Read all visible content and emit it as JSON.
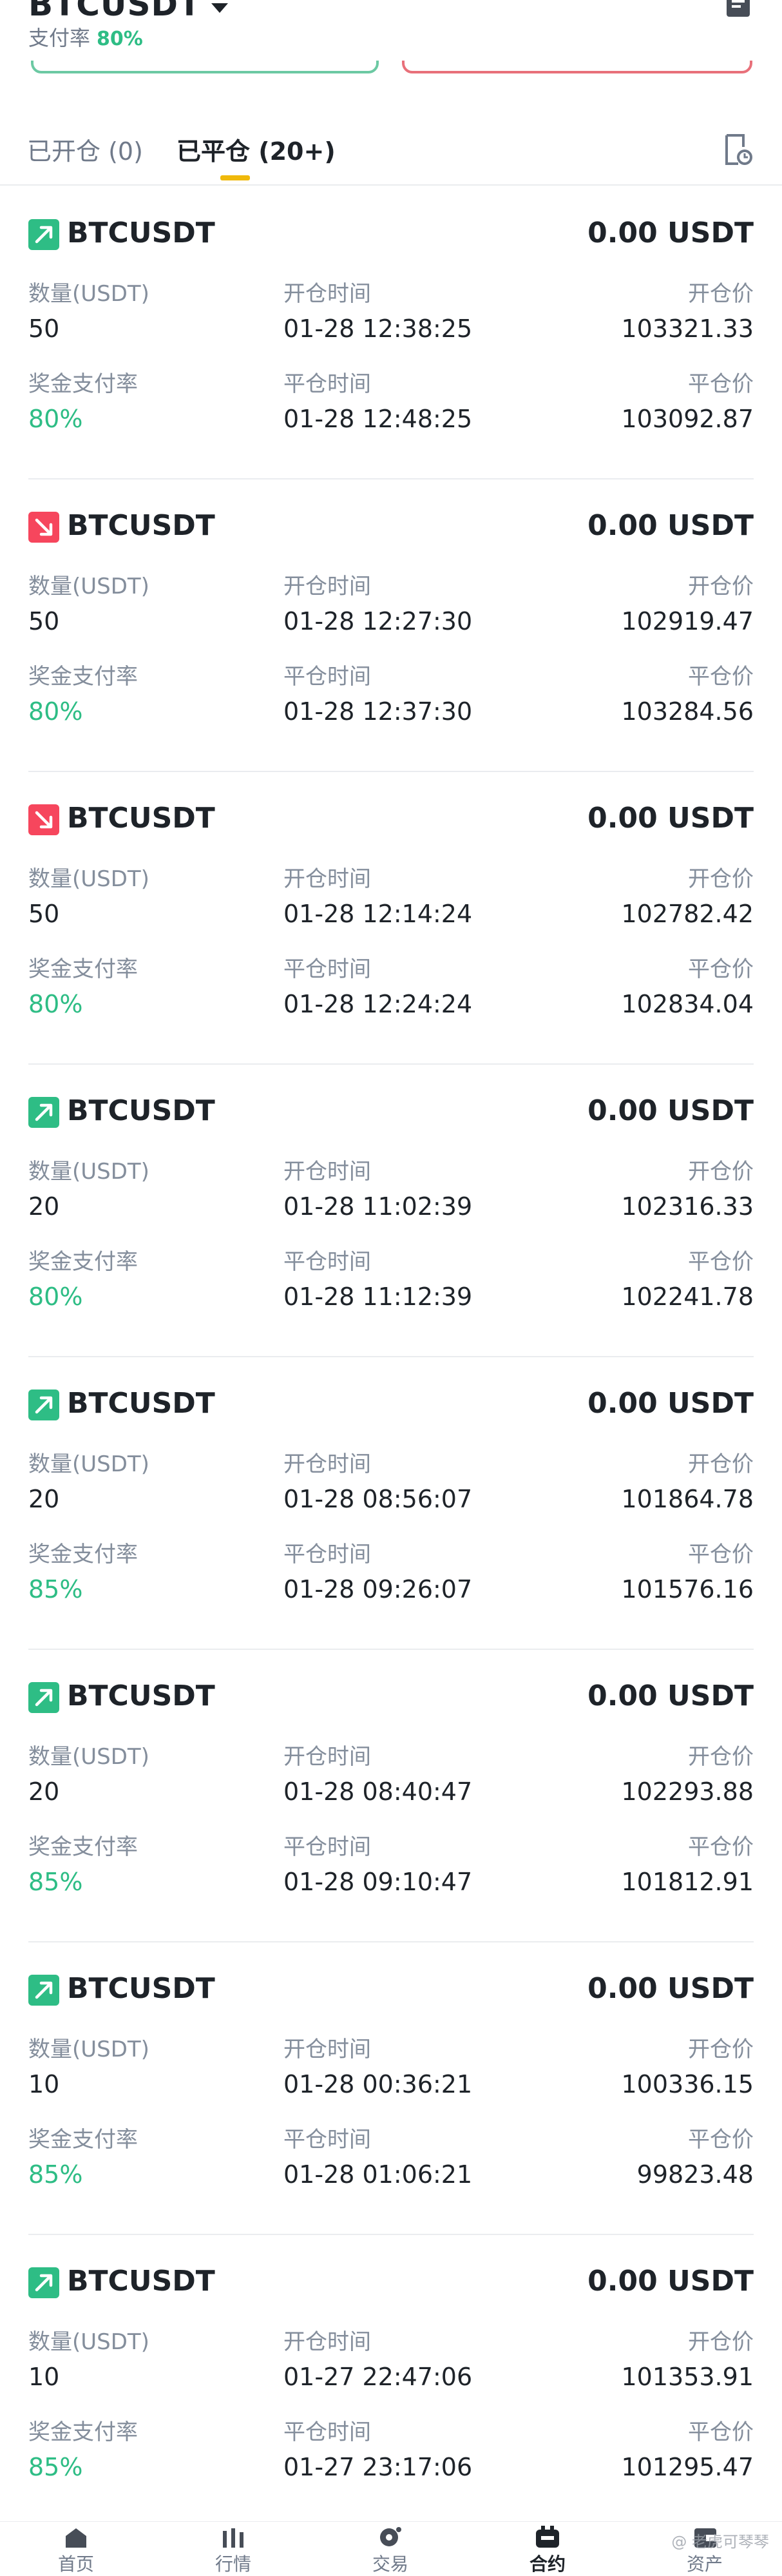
{
  "header": {
    "symbol": "BTCUSDT",
    "payout_label": "支付率",
    "payout_value": "80%"
  },
  "tabs": {
    "open_label": "已开仓 (0)",
    "closed_label": "已平仓 (20+)"
  },
  "labels": {
    "quantity": "数量(USDT)",
    "open_time": "开仓时间",
    "open_price": "开仓价",
    "payout_rate": "奖金支付率",
    "close_time": "平仓时间",
    "close_price": "平仓价"
  },
  "colors": {
    "up": "#2ebd85",
    "down": "#f6465d",
    "accent": "#f0b90b"
  },
  "trades": [
    {
      "direction": "up",
      "symbol": "BTCUSDT",
      "pnl": "0.00 USDT",
      "quantity": "50",
      "open_time": "01-28 12:38:25",
      "open_price": "103321.33",
      "payout_rate": "80%",
      "close_time": "01-28 12:48:25",
      "close_price": "103092.87"
    },
    {
      "direction": "down",
      "symbol": "BTCUSDT",
      "pnl": "0.00 USDT",
      "quantity": "50",
      "open_time": "01-28 12:27:30",
      "open_price": "102919.47",
      "payout_rate": "80%",
      "close_time": "01-28 12:37:30",
      "close_price": "103284.56"
    },
    {
      "direction": "down",
      "symbol": "BTCUSDT",
      "pnl": "0.00 USDT",
      "quantity": "50",
      "open_time": "01-28 12:14:24",
      "open_price": "102782.42",
      "payout_rate": "80%",
      "close_time": "01-28 12:24:24",
      "close_price": "102834.04"
    },
    {
      "direction": "up",
      "symbol": "BTCUSDT",
      "pnl": "0.00 USDT",
      "quantity": "20",
      "open_time": "01-28 11:02:39",
      "open_price": "102316.33",
      "payout_rate": "80%",
      "close_time": "01-28 11:12:39",
      "close_price": "102241.78"
    },
    {
      "direction": "up",
      "symbol": "BTCUSDT",
      "pnl": "0.00 USDT",
      "quantity": "20",
      "open_time": "01-28 08:56:07",
      "open_price": "101864.78",
      "payout_rate": "85%",
      "close_time": "01-28 09:26:07",
      "close_price": "101576.16"
    },
    {
      "direction": "up",
      "symbol": "BTCUSDT",
      "pnl": "0.00 USDT",
      "quantity": "20",
      "open_time": "01-28 08:40:47",
      "open_price": "102293.88",
      "payout_rate": "85%",
      "close_time": "01-28 09:10:47",
      "close_price": "101812.91"
    },
    {
      "direction": "up",
      "symbol": "BTCUSDT",
      "pnl": "0.00 USDT",
      "quantity": "10",
      "open_time": "01-28 00:36:21",
      "open_price": "100336.15",
      "payout_rate": "85%",
      "close_time": "01-28 01:06:21",
      "close_price": "99823.48"
    },
    {
      "direction": "up",
      "symbol": "BTCUSDT",
      "pnl": "0.00 USDT",
      "quantity": "10",
      "open_time": "01-27 22:47:06",
      "open_price": "101353.91",
      "payout_rate": "85%",
      "close_time": "01-27 23:17:06",
      "close_price": "101295.47"
    }
  ],
  "bottom_nav": [
    {
      "label": "首页",
      "icon": "home-icon",
      "active": false
    },
    {
      "label": "行情",
      "icon": "markets-icon",
      "active": false
    },
    {
      "label": "交易",
      "icon": "trade-icon",
      "active": false
    },
    {
      "label": "合约",
      "icon": "futures-icon",
      "active": true
    },
    {
      "label": "资产",
      "icon": "wallet-icon",
      "active": false
    }
  ],
  "watermark": "@ 老虎可琴琴"
}
